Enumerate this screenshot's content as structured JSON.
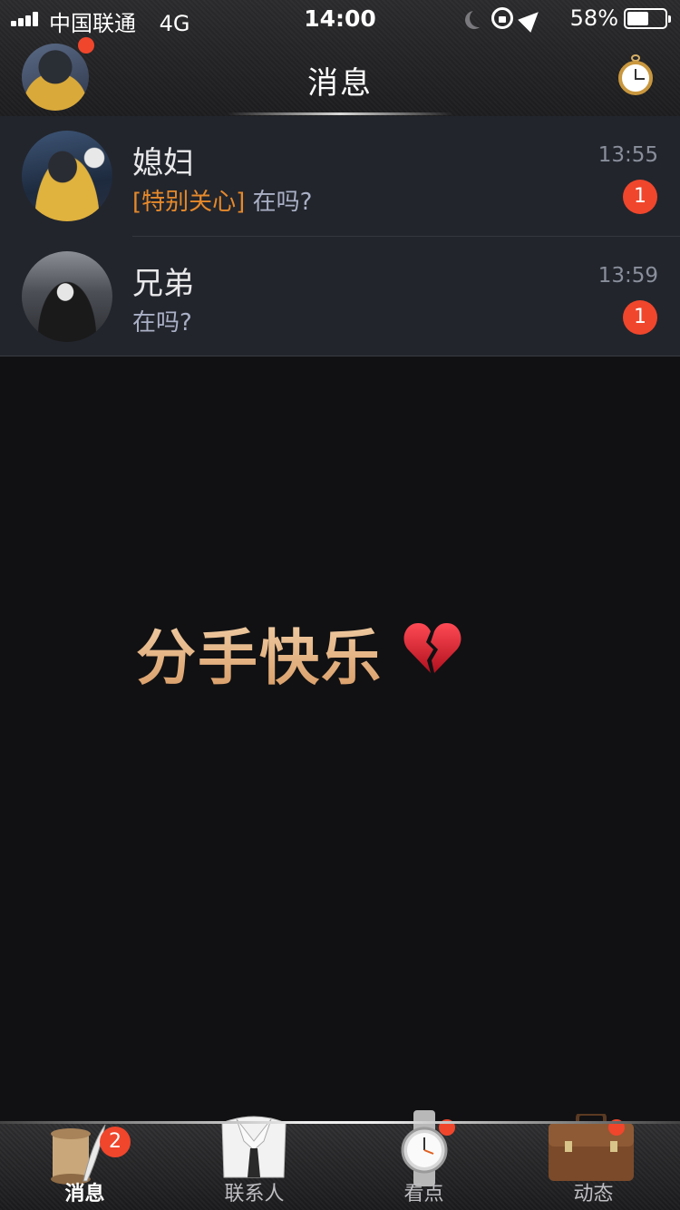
{
  "status_bar": {
    "carrier": "中国联通",
    "network": "4G",
    "time": "14:00",
    "battery_percent": "58%",
    "battery_level": 0.58
  },
  "header": {
    "title": "消息",
    "has_avatar_dot": true
  },
  "conversations": [
    {
      "name": "媳妇",
      "tag": "[特别关心]",
      "preview": "在吗?",
      "time": "13:55",
      "unread": "1"
    },
    {
      "name": "兄弟",
      "tag": "",
      "preview": "在吗?",
      "time": "13:59",
      "unread": "1"
    }
  ],
  "center_text": "分手快乐",
  "center_emoji_icon": "broken-heart-icon",
  "tabs": [
    {
      "label": "消息",
      "icon": "scroll-quill-icon",
      "badge": "2",
      "active": true
    },
    {
      "label": "联系人",
      "icon": "shirt-tie-icon",
      "badge": "",
      "active": false
    },
    {
      "label": "看点",
      "icon": "wristwatch-icon",
      "badge": "dot",
      "active": false
    },
    {
      "label": "动态",
      "icon": "briefcase-icon",
      "badge": "dot",
      "active": false
    }
  ],
  "colors": {
    "badge_red": "#f0462c",
    "tag_orange": "#e6892b",
    "list_bg": "#22252c",
    "page_bg": "#111113"
  }
}
